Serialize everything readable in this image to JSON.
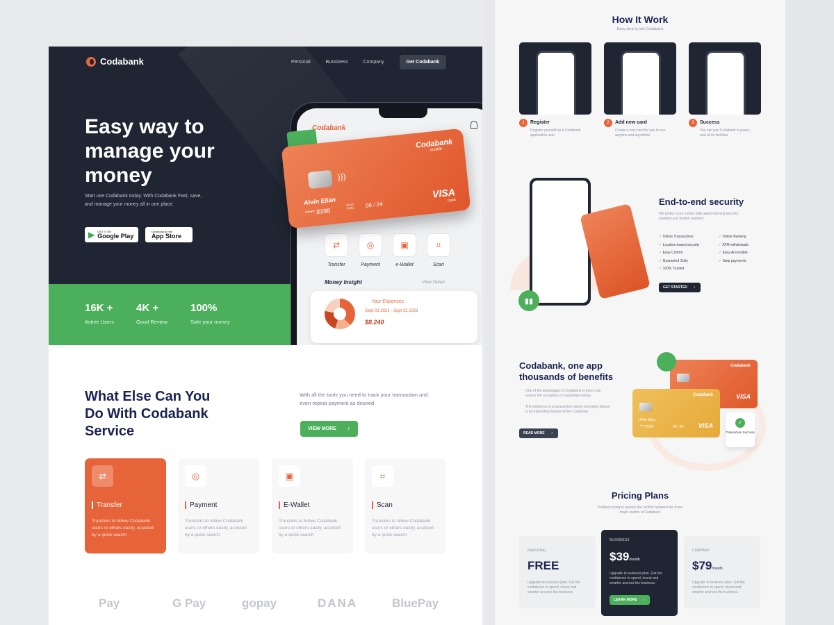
{
  "hero": {
    "brand": "Codabank",
    "nav": [
      "Personal",
      "Bussiness",
      "Company"
    ],
    "cta": "Get Codabank",
    "title": "Easy way to manage your money",
    "subtitle": "Start use Codabank today. With Codabank Fast, save, and manage your money all in one place.",
    "google_small": "GET IT ON",
    "google_big": "Google Play",
    "apple_small": "Download on the",
    "apple_big": "App Store",
    "stats": [
      {
        "value": "16K +",
        "label": "Active Users"
      },
      {
        "value": "4K +",
        "label": "Good Review"
      },
      {
        "value": "100%",
        "label": "Safe your money"
      }
    ]
  },
  "phone": {
    "brand": "Codabank",
    "brand_sub": "mobile",
    "actions": [
      "Transfer",
      "Payment",
      "e-Wallet",
      "Scan"
    ],
    "insight_title": "Money Insight",
    "view_detail": "View Detail",
    "expenses_label": "Your Expenses",
    "expenses_dates": "Sept 01 2021 - Sept 31 2021",
    "expenses_amount": "$8.240"
  },
  "card": {
    "brand": "Codabank",
    "brand_sub": "mobile",
    "holder": "Alvin Elian",
    "number": "**** 8398",
    "valid_label": "VALID THRU",
    "expiry": "06 / 24",
    "network": "VISA",
    "network_sub": "Debit"
  },
  "services": {
    "title": "What Else Can You Do With Codabank Service",
    "description": "With all the tools you need to track your transaction and even repeat payment as desired",
    "view_more": "VIEW MORE",
    "items": [
      {
        "title": "Transfer",
        "desc": "Transfers to fellow Codabank users or others easily, assisted by a quick search"
      },
      {
        "title": "Payment",
        "desc": "Transfers to fellow Codabank users or others easily, assisted by a quick search"
      },
      {
        "title": "E-Wallet",
        "desc": "Transfers to fellow Codabank users or others easily, assisted by a quick search"
      },
      {
        "title": "Scan",
        "desc": "Transfers to fellow Codabank users or others easily, assisted by a quick search"
      }
    ],
    "partners": [
      "Pay",
      "G Pay",
      "gopay",
      "DANA",
      "BluePay"
    ]
  },
  "how": {
    "title": "How It Work",
    "subtitle": "Easy step to join Codabank",
    "steps": [
      {
        "n": "1",
        "title": "Register",
        "desc": "Register yourself as a Codabank application user"
      },
      {
        "n": "2",
        "title": "Add new card",
        "desc": "Create a new card for you to use anytime and anywhere"
      },
      {
        "n": "3",
        "title": "Success",
        "desc": "You can use Codabank in peace and all its facilities"
      }
    ]
  },
  "security": {
    "title": "End-to-end security",
    "desc": "We protect your money with award-winning security systems and trusted partners",
    "features_left": [
      "Online Transactions",
      "Location-based security",
      "Easy Control",
      "Guaranted Softy",
      "100% Trusted"
    ],
    "features_right": [
      "Online Banking",
      "ATM withdrawals",
      "Easy Accessible",
      "Swip payments"
    ],
    "cta": "GET STARTED"
  },
  "benefits": {
    "title": "Codabank, one app thousands of benefits",
    "bullets": [
      "One of the advantages of Codabank is that it can reduce the circulation of counterfeit money",
      "The existence of a transaction history recording feature is an interesting feature of the Codabank"
    ],
    "cta": "READ MORE",
    "card_brand": "Codabank",
    "card_visa": "VISA",
    "card_holder": "Alvin Elian",
    "card_number": "**** 2504",
    "card_exp": "06 / 24",
    "toast": "Transaction Success"
  },
  "pricing": {
    "title": "Pricing Plans",
    "subtitle": "Problem trying to resolve the conflict between the three major realms of Codabank",
    "plans": [
      {
        "name": "PERSONAL",
        "price": "FREE",
        "per": "",
        "desc": "Upgrade to business plan. Get the confidence to spend, invest and smarter accross the business."
      },
      {
        "name": "BUSSINESS",
        "price": "$39",
        "per": "/month",
        "desc": "Upgrade to business plan. Get the confidence to spend, invest and smarter accross the business."
      },
      {
        "name": "COMPANY",
        "price": "$79",
        "per": "/month",
        "desc": "Upgrade to business plan. Get the confidence to spend, invest and smarter accross the business."
      }
    ],
    "cta": "LEARN MORE"
  },
  "colors": {
    "accent": "#e7643a",
    "green": "#4caf5b",
    "dark": "#1f2532"
  }
}
